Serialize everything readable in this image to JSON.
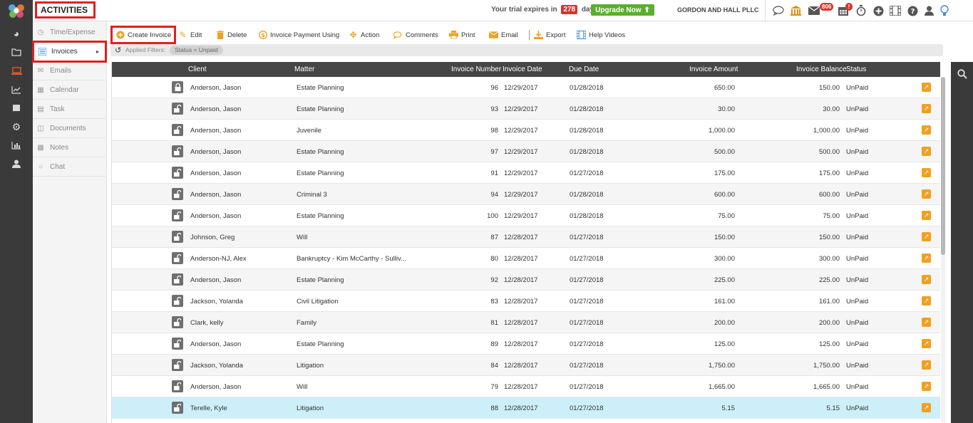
{
  "header": {
    "title": "ACTIVITIES",
    "trial_prefix": "Your trial expires in",
    "trial_days": "278",
    "trial_suffix": "days.",
    "upgrade_label": "Upgrade Now",
    "firm_name": "GORDON AND HALL PLLC",
    "mail_badge": "806",
    "calendar_badge": "!"
  },
  "sidebar": {
    "items": [
      {
        "label": "Time/Expense",
        "icon": "clock-icon"
      },
      {
        "label": "Invoices",
        "icon": "invoice-icon"
      },
      {
        "label": "Emails",
        "icon": "envelope-icon"
      },
      {
        "label": "Calendar",
        "icon": "calendar-icon"
      },
      {
        "label": "Task",
        "icon": "task-icon"
      },
      {
        "label": "Documents",
        "icon": "folder-icon"
      },
      {
        "label": "Notes",
        "icon": "note-icon"
      },
      {
        "label": "Chat",
        "icon": "chat-icon"
      }
    ]
  },
  "toolbar": {
    "create": "Create Invoice",
    "edit": "Edit",
    "delete": "Delete",
    "payment": "Invoice Payment Using",
    "action": "Action",
    "comments": "Comments",
    "print": "Print",
    "email": "Email",
    "export": "Export",
    "help": "Help Videos"
  },
  "filters": {
    "label": "Applied Filters:",
    "chip": "Status = Unpaid"
  },
  "table": {
    "columns": {
      "client": "Client",
      "matter": "Matter",
      "number": "Invoice Number",
      "date": "Invoice Date",
      "due": "Due Date",
      "amount": "Invoice Amount",
      "balance": "Invoice Balance",
      "status": "Status"
    },
    "rows": [
      {
        "locked": true,
        "client": "Anderson, Jason",
        "matter": "Estate Planning",
        "number": "96",
        "date": "12/29/2017",
        "due": "01/28/2018",
        "amount": "650.00",
        "balance": "150.00",
        "status": "UnPaid"
      },
      {
        "locked": false,
        "client": "Anderson, Jason",
        "matter": "Estate Planning",
        "number": "93",
        "date": "12/29/2017",
        "due": "01/28/2018",
        "amount": "30.00",
        "balance": "30.00",
        "status": "UnPaid"
      },
      {
        "locked": false,
        "client": "Anderson, Jason",
        "matter": "Juvenile",
        "number": "98",
        "date": "12/29/2017",
        "due": "01/28/2018",
        "amount": "1,000.00",
        "balance": "1,000.00",
        "status": "UnPaid"
      },
      {
        "locked": false,
        "client": "Anderson, Jason",
        "matter": "Estate Planning",
        "number": "97",
        "date": "12/29/2017",
        "due": "01/28/2018",
        "amount": "500.00",
        "balance": "500.00",
        "status": "UnPaid"
      },
      {
        "locked": false,
        "client": "Anderson, Jason",
        "matter": "Estate Planning",
        "number": "91",
        "date": "12/29/2017",
        "due": "01/27/2018",
        "amount": "175.00",
        "balance": "175.00",
        "status": "UnPaid"
      },
      {
        "locked": false,
        "client": "Anderson, Jason",
        "matter": "Criminal 3",
        "number": "94",
        "date": "12/29/2017",
        "due": "01/28/2018",
        "amount": "600.00",
        "balance": "600.00",
        "status": "UnPaid"
      },
      {
        "locked": false,
        "client": "Anderson, Jason",
        "matter": "Estate Planning",
        "number": "100",
        "date": "12/29/2017",
        "due": "01/28/2018",
        "amount": "75.00",
        "balance": "75.00",
        "status": "UnPaid"
      },
      {
        "locked": false,
        "client": "Johnson, Greg",
        "matter": "Will",
        "number": "87",
        "date": "12/28/2017",
        "due": "01/27/2018",
        "amount": "150.00",
        "balance": "150.00",
        "status": "UnPaid"
      },
      {
        "locked": false,
        "client": "Anderson-NJ, Alex",
        "matter": "Bankruptcy - Kim McCarthy - Sulliv...",
        "number": "80",
        "date": "12/28/2017",
        "due": "01/27/2018",
        "amount": "300.00",
        "balance": "300.00",
        "status": "UnPaid"
      },
      {
        "locked": false,
        "client": "Anderson, Jason",
        "matter": "Estate Planning",
        "number": "92",
        "date": "12/28/2017",
        "due": "01/27/2018",
        "amount": "225.00",
        "balance": "225.00",
        "status": "UnPaid"
      },
      {
        "locked": false,
        "client": "Jackson, Yolanda",
        "matter": "Civil Litigation",
        "number": "83",
        "date": "12/28/2017",
        "due": "01/27/2018",
        "amount": "161.00",
        "balance": "161.00",
        "status": "UnPaid"
      },
      {
        "locked": false,
        "client": "Clark, kelly",
        "matter": "Family",
        "number": "81",
        "date": "12/28/2017",
        "due": "01/27/2018",
        "amount": "200.00",
        "balance": "200.00",
        "status": "UnPaid"
      },
      {
        "locked": false,
        "client": "Anderson, Jason",
        "matter": "Estate Planning",
        "number": "89",
        "date": "12/28/2017",
        "due": "01/27/2018",
        "amount": "125.00",
        "balance": "125.00",
        "status": "UnPaid"
      },
      {
        "locked": false,
        "client": "Jackson, Yolanda",
        "matter": "Litigation",
        "number": "84",
        "date": "12/28/2017",
        "due": "01/27/2018",
        "amount": "1,750.00",
        "balance": "1,750.00",
        "status": "UnPaid"
      },
      {
        "locked": false,
        "client": "Anderson, Jason",
        "matter": "Will",
        "number": "79",
        "date": "12/28/2017",
        "due": "01/27/2018",
        "amount": "1,665.00",
        "balance": "1,665.00",
        "status": "UnPaid"
      },
      {
        "locked": false,
        "selected": true,
        "client": "Terelle, Kyle",
        "matter": "Litigation",
        "number": "88",
        "date": "12/28/2017",
        "due": "01/27/2018",
        "amount": "5.15",
        "balance": "5.15",
        "status": "UnPaid"
      }
    ]
  },
  "colors": {
    "accent": "#f0a020",
    "highlight": "#e02020",
    "header": "#464646",
    "upgrade": "#5cae2e",
    "selected_row": "#cdeff9"
  }
}
